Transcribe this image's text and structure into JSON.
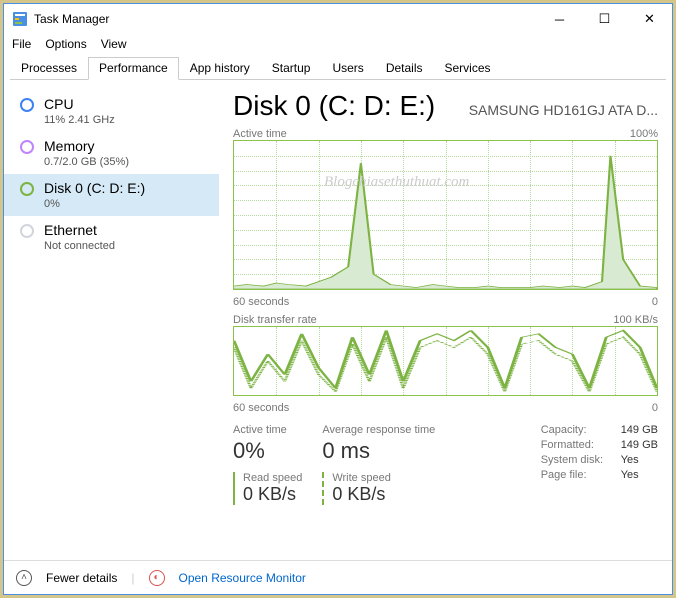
{
  "window": {
    "title": "Task Manager"
  },
  "menu": {
    "file": "File",
    "options": "Options",
    "view": "View"
  },
  "tabs": {
    "processes": "Processes",
    "performance": "Performance",
    "apphistory": "App history",
    "startup": "Startup",
    "users": "Users",
    "details": "Details",
    "services": "Services"
  },
  "sidebar": {
    "cpu": {
      "name": "CPU",
      "sub": "11% 2.41 GHz"
    },
    "memory": {
      "name": "Memory",
      "sub": "0.7/2.0 GB (35%)"
    },
    "disk": {
      "name": "Disk 0 (C: D: E:)",
      "sub": "0%"
    },
    "ethernet": {
      "name": "Ethernet",
      "sub": "Not connected"
    }
  },
  "main": {
    "title": "Disk 0 (C: D: E:)",
    "model": "SAMSUNG HD161GJ ATA D...",
    "chart1": {
      "label": "Active time",
      "max": "100%",
      "xleft": "60 seconds",
      "xright": "0"
    },
    "chart2": {
      "label": "Disk transfer rate",
      "max": "100 KB/s",
      "xleft": "60 seconds",
      "xright": "0"
    },
    "stats": {
      "active_label": "Active time",
      "active_value": "0%",
      "resp_label": "Average response time",
      "resp_value": "0 ms",
      "read_label": "Read speed",
      "read_value": "0 KB/s",
      "write_label": "Write speed",
      "write_value": "0 KB/s"
    },
    "info": {
      "capacity_k": "Capacity:",
      "capacity_v": "149 GB",
      "formatted_k": "Formatted:",
      "formatted_v": "149 GB",
      "sysdisk_k": "System disk:",
      "sysdisk_v": "Yes",
      "pagefile_k": "Page file:",
      "pagefile_v": "Yes"
    }
  },
  "footer": {
    "fewer": "Fewer details",
    "monitor": "Open Resource Monitor"
  },
  "watermark": "Blogchiasethuthuat.com",
  "chart_data": [
    {
      "type": "line",
      "title": "Active time",
      "xlabel": "60 seconds → 0",
      "ylabel": "Active time (%)",
      "ylim": [
        0,
        100
      ],
      "x_seconds_ago": [
        60,
        58,
        56,
        54,
        52,
        50,
        48,
        46,
        44,
        42,
        40,
        38,
        36,
        34,
        32,
        30,
        28,
        26,
        24,
        22,
        20,
        18,
        16,
        14,
        12,
        10,
        8,
        6,
        4,
        2,
        0
      ],
      "values_pct": [
        2,
        3,
        2,
        4,
        3,
        2,
        5,
        8,
        15,
        85,
        10,
        3,
        2,
        1,
        3,
        2,
        1,
        1,
        2,
        1,
        1,
        1,
        2,
        1,
        2,
        1,
        5,
        90,
        20,
        2,
        1
      ]
    },
    {
      "type": "line",
      "title": "Disk transfer rate",
      "xlabel": "60 seconds → 0",
      "ylabel": "KB/s",
      "ylim": [
        0,
        100
      ],
      "series": [
        {
          "name": "Read speed",
          "x_seconds_ago": [
            60,
            55,
            50,
            45,
            42,
            40,
            38,
            36,
            34,
            32,
            30,
            28,
            26,
            24,
            22,
            20,
            18,
            16,
            14,
            12,
            10,
            8,
            6,
            4,
            2,
            0
          ],
          "values_kbs": [
            80,
            20,
            60,
            30,
            90,
            40,
            10,
            85,
            30,
            95,
            20,
            80,
            90,
            80,
            95,
            70,
            10,
            85,
            90,
            70,
            60,
            10,
            85,
            95,
            70,
            10
          ]
        },
        {
          "name": "Write speed",
          "x_seconds_ago": [
            60,
            55,
            50,
            45,
            42,
            40,
            38,
            36,
            34,
            32,
            30,
            28,
            26,
            24,
            22,
            20,
            18,
            16,
            14,
            12,
            10,
            8,
            6,
            4,
            2,
            0
          ],
          "values_kbs": [
            70,
            10,
            50,
            20,
            80,
            30,
            5,
            75,
            20,
            85,
            10,
            70,
            80,
            70,
            85,
            60,
            5,
            75,
            80,
            60,
            50,
            5,
            75,
            85,
            60,
            5
          ]
        }
      ]
    }
  ]
}
